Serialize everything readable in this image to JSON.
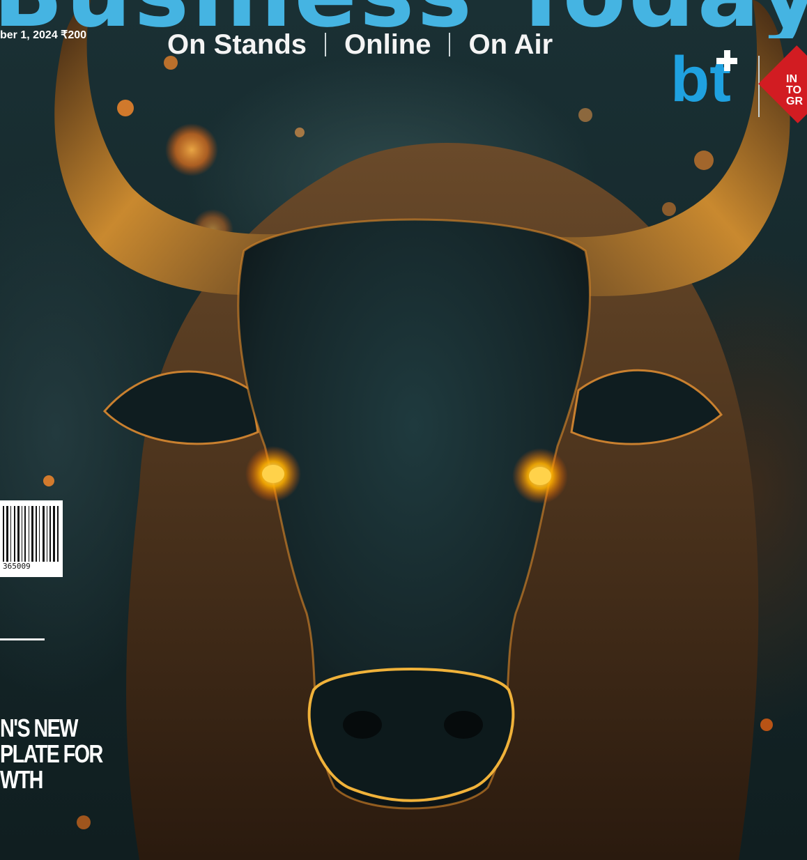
{
  "masthead": {
    "title": "Business Today"
  },
  "dateline": "ber 1, 2024 ₹200",
  "tagline": {
    "items": [
      "On Stands",
      "Online",
      "On Air"
    ]
  },
  "brand": {
    "logo_text": "bt",
    "partner_text": [
      "IN",
      "TO",
      "GR"
    ]
  },
  "barcode": {
    "digits": "365009"
  },
  "coverline": {
    "lines": [
      "N'S NEW",
      "PLATE FOR",
      "WTH"
    ]
  },
  "colors": {
    "masthead": "#45b4e2",
    "logo": "#1fa1e0",
    "partner": "#d21c22",
    "eyes": "#ffb000",
    "glow": "#ff7a1a"
  }
}
